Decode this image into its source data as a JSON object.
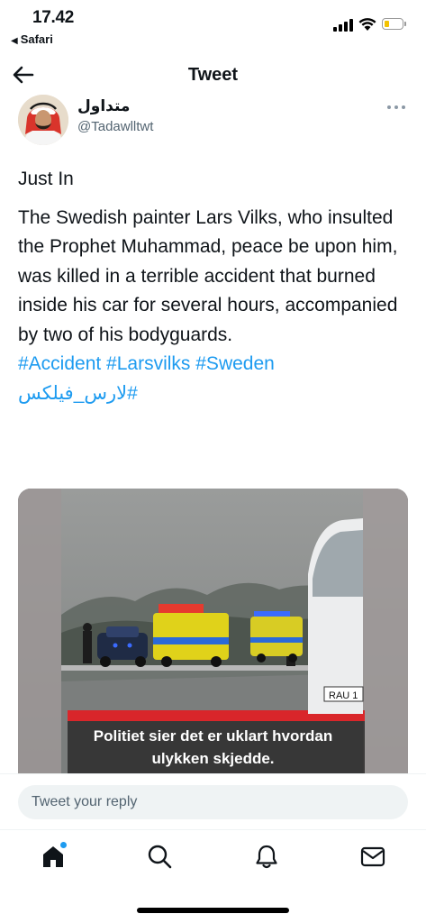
{
  "status_bar": {
    "time": "17.42",
    "back_app": "Safari",
    "battery_color": "#f3c200"
  },
  "header": {
    "title": "Tweet",
    "back_icon": "arrow-left-icon"
  },
  "author": {
    "display_name": "متداول",
    "handle": "@Tadawlltwt",
    "more_icon": "more-horizontal-icon"
  },
  "tweet": {
    "line_intro": "Just In",
    "body": "The Swedish painter Lars Vilks, who insulted the Prophet Muhammad, peace be upon him, was killed in a terrible accident that burned inside his car for several hours, accompanied by two of his bodyguards.",
    "hashtags": "#Accident #Larsvilks #Sweden",
    "arabic_hashtag": "#لارس_فيلكس",
    "link_color": "#1d9bf0"
  },
  "media": {
    "caption_line1": "Politiet sier det er uklart hvordan",
    "caption_line2": "ulykken skjedde.",
    "plate_text": "RAU 1"
  },
  "reply": {
    "placeholder": "Tweet your reply"
  },
  "tabs": [
    {
      "icon": "home-icon",
      "active": true,
      "notification_dot": true
    },
    {
      "icon": "search-icon",
      "active": false
    },
    {
      "icon": "notifications-icon",
      "active": false
    },
    {
      "icon": "messages-icon",
      "active": false
    }
  ]
}
